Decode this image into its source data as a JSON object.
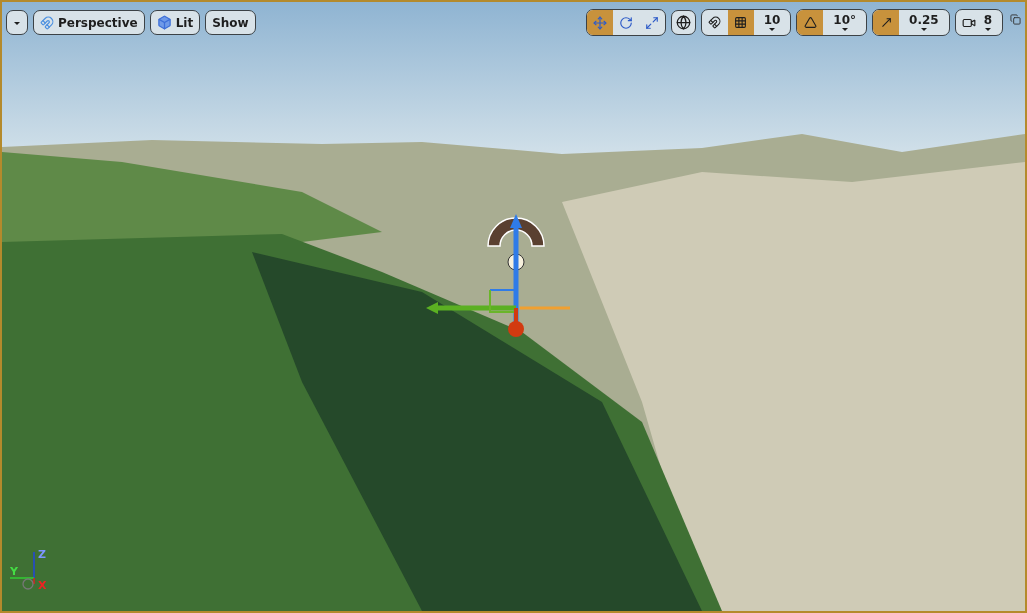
{
  "toolbar_left": {
    "view_mode": "Perspective",
    "lighting": "Lit",
    "show": "Show"
  },
  "transform_tools": [
    {
      "kind": "translate",
      "selected": true
    },
    {
      "kind": "rotate",
      "selected": false
    },
    {
      "kind": "scale",
      "selected": false
    }
  ],
  "snap_tools": [
    {
      "kind": "grid",
      "on": true,
      "value": "10"
    },
    {
      "kind": "rotation",
      "on": true,
      "value": "10°"
    },
    {
      "kind": "scale",
      "on": true,
      "value": "0.25"
    }
  ],
  "camera_speed": "8",
  "axis_labels": {
    "z": "Z",
    "y": "Y",
    "x": "X"
  }
}
